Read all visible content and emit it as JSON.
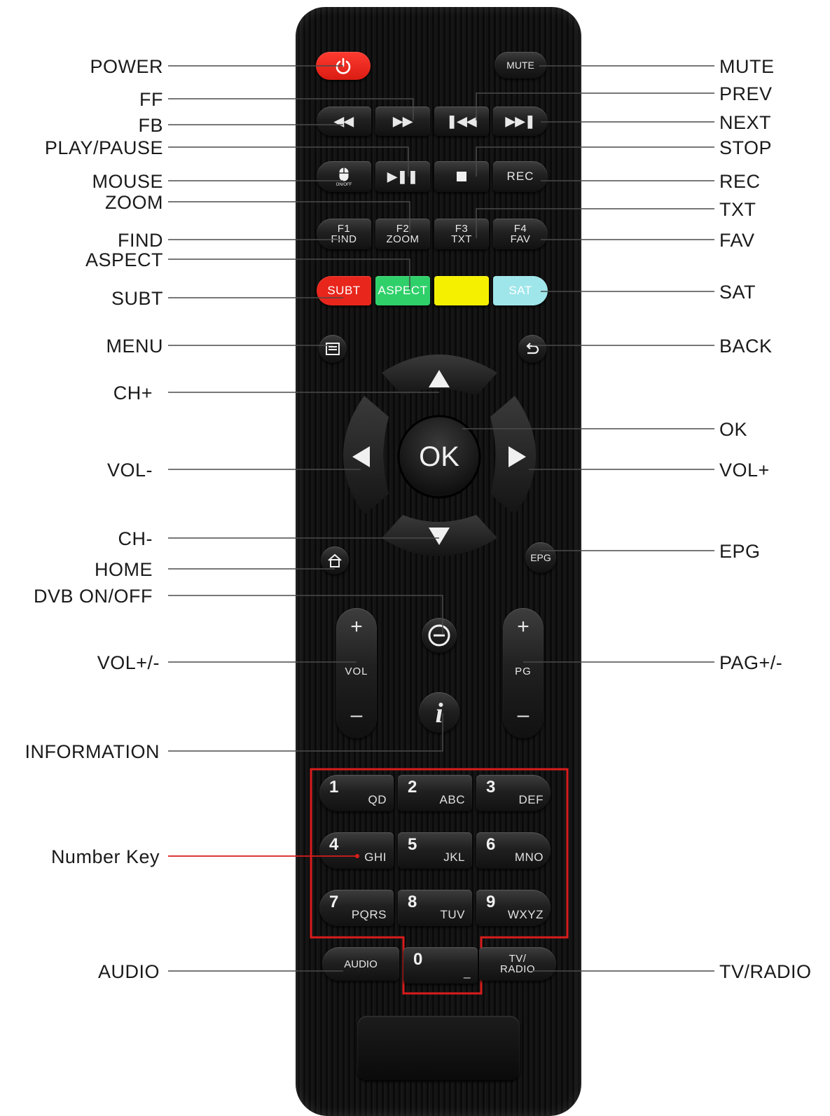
{
  "labels_left": {
    "power": "POWER",
    "ff": "FF",
    "fb": "FB",
    "play_pause": "PLAY/PAUSE",
    "mouse": "MOUSE",
    "zoom": "ZOOM",
    "find": "FIND",
    "aspect": "ASPECT",
    "subt": "SUBT",
    "menu": "MENU",
    "ch_plus": "CH+",
    "vol_minus": "VOL-",
    "ch_minus": "CH-",
    "home": "HOME",
    "dvb_onoff": "DVB ON/OFF",
    "vol_plus_minus": "VOL+/-",
    "information": "INFORMATION",
    "number_key": "Number Key",
    "audio": "AUDIO"
  },
  "labels_right": {
    "mute": "MUTE",
    "prev": "PREV",
    "next": "NEXT",
    "stop": "STOP",
    "rec": "REC",
    "txt": "TXT",
    "fav": "FAV",
    "sat": "SAT",
    "back": "BACK",
    "ok": "OK",
    "vol_plus": "VOL+",
    "epg": "EPG",
    "pag_plus_minus": "PAG+/-",
    "tv_radio": "TV/RADIO"
  },
  "remote": {
    "mute_key": "MUTE",
    "mouse_sub": "ON/OFF",
    "rec_key": "REC",
    "f1_top": "F1",
    "f1_bottom": "FIND",
    "f2_top": "F2",
    "f2_bottom": "ZOOM",
    "f3_top": "F3",
    "f3_bottom": "TXT",
    "f4_top": "F4",
    "f4_bottom": "FAV",
    "subt_key": "SUBT",
    "aspect_key": "ASPECT",
    "sat_key": "SAT",
    "ok_key": "OK",
    "epg_key": "EPG",
    "vol_key": "VOL",
    "pg_key": "PG",
    "plus": "+",
    "minus": "–",
    "info_key": "i",
    "audio_key": "AUDIO",
    "tvradio_top": "TV/",
    "tvradio_bottom": "RADIO",
    "number_keys": [
      {
        "n": "1",
        "l": "QD"
      },
      {
        "n": "2",
        "l": "ABC"
      },
      {
        "n": "3",
        "l": "DEF"
      },
      {
        "n": "4",
        "l": "GHI"
      },
      {
        "n": "5",
        "l": "JKL"
      },
      {
        "n": "6",
        "l": "MNO"
      },
      {
        "n": "7",
        "l": "PQRS"
      },
      {
        "n": "8",
        "l": "TUV"
      },
      {
        "n": "9",
        "l": "WXYZ"
      },
      {
        "n": "0",
        "l": "_"
      }
    ]
  },
  "colors": {
    "power_red": "#e8261c",
    "subt_red": "#e8261c",
    "aspect_green": "#2fd06a",
    "yellow": "#f5f000",
    "sat_cyan": "#9fe6ea",
    "callout_line": "#4a4a4a",
    "number_key_highlight": "#d91c1c"
  }
}
